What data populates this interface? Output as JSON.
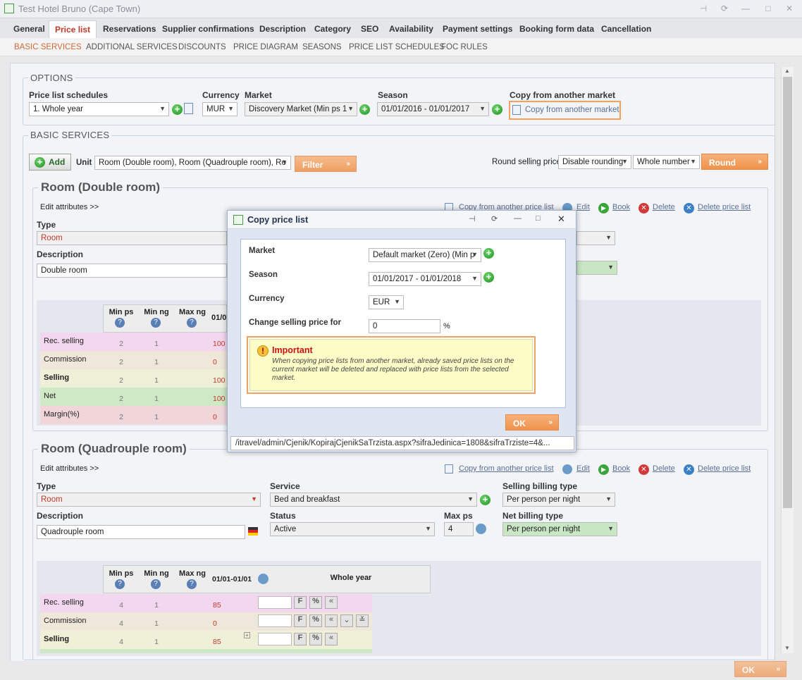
{
  "window": {
    "title": "Test Hotel Bruno (Cape Town)"
  },
  "tabs": [
    "General",
    "Price list",
    "Reservations",
    "Supplier confirmations",
    "Description",
    "Category",
    "SEO",
    "Availability",
    "Payment settings",
    "Booking form data",
    "Cancellation"
  ],
  "subtabs": [
    "BASIC SERVICES",
    "ADDITIONAL SERVICES",
    "DISCOUNTS",
    "PRICE DIAGRAM",
    "SEASONS",
    "PRICE LIST SCHEDULES",
    "FOC RULES"
  ],
  "options": {
    "legend": "OPTIONS",
    "schedules_label": "Price list schedules",
    "schedules_value": "1. Whole year",
    "currency_label": "Currency",
    "currency_value": "MUR",
    "market_label": "Market",
    "market_value": "Discovery Market (Min ps 1",
    "season_label": "Season",
    "season_value": "01/01/2016 - 01/01/2017",
    "copy_label": "Copy from another market",
    "copy_link": "Copy from another market"
  },
  "basic": {
    "legend": "BASIC SERVICES",
    "add": "Add",
    "unit_label": "Unit",
    "unit_value": "Room (Double room), Room (Quadrouple room), Ro",
    "filter": "Filter",
    "round_label": "Round selling price",
    "rounding_value": "Disable rounding",
    "number_value": "Whole number",
    "round_btn": "Round"
  },
  "room1": {
    "title": "Room (Double room)",
    "edit_attrs": "Edit attributes >>",
    "type_label": "Type",
    "type_value": "Room",
    "desc_label": "Description",
    "desc_value": "Double room",
    "actions": [
      "Copy from another price list",
      "Edit",
      "Book",
      "Delete",
      "Delete price list"
    ],
    "grid": {
      "headers": [
        "Min ps",
        "Min ng",
        "Max ng",
        "01/0"
      ],
      "rows": [
        {
          "label": "Rec. selling",
          "min_ps": "2",
          "min_ng": "1",
          "val": "100"
        },
        {
          "label": "Commission",
          "min_ps": "2",
          "min_ng": "1",
          "val": "0"
        },
        {
          "label": "Selling",
          "min_ps": "2",
          "min_ng": "1",
          "val": "100"
        },
        {
          "label": "Net",
          "min_ps": "2",
          "min_ng": "1",
          "val": "100"
        },
        {
          "label": "Margin(%)",
          "min_ps": "2",
          "min_ng": "1",
          "val": "0"
        }
      ]
    }
  },
  "room2": {
    "title": "Room (Quadrouple room)",
    "edit_attrs": "Edit attributes >>",
    "type_label": "Type",
    "type_value": "Room",
    "desc_label": "Description",
    "desc_value": "Quadrouple room",
    "service_label": "Service",
    "service_value": "Bed and breakfast",
    "status_label": "Status",
    "status_value": "Active",
    "maxps_label": "Max ps",
    "maxps_value": "4",
    "sbt_label": "Selling billing type",
    "sbt_value": "Per person per night",
    "nbt_label": "Net billing type",
    "nbt_value": "Per person per night",
    "actions": [
      "Copy from another price list",
      "Edit",
      "Book",
      "Delete",
      "Delete price list"
    ],
    "grid": {
      "headers": [
        "Min ps",
        "Min ng",
        "Max ng",
        "01/01-01/01",
        "Whole year"
      ],
      "rows": [
        {
          "label": "Rec. selling",
          "min_ps": "4",
          "min_ng": "1",
          "val": "85"
        },
        {
          "label": "Commission",
          "min_ps": "4",
          "min_ng": "1",
          "val": "0"
        },
        {
          "label": "Selling",
          "min_ps": "4",
          "min_ng": "1",
          "val": "85"
        }
      ],
      "btn_f": "F",
      "btn_pct": "%"
    }
  },
  "modal": {
    "title": "Copy price list",
    "market_label": "Market",
    "market_value": "Default market (Zero) (Min p",
    "season_label": "Season",
    "season_value": "01/01/2017 - 01/01/2018",
    "currency_label": "Currency",
    "currency_value": "EUR",
    "change_label": "Change selling price for",
    "change_value": "0",
    "pct": "%",
    "important_title": "Important",
    "important_text": "When copying price lists from another market, already saved price lists on the current market will be deleted and replaced with price lists from the selected market.",
    "ok": "OK",
    "url": "/itravel/admin/Cjenik/KopirajCjenikSaTrzista.aspx?sifraJedinica=1808&sifraTrziste=4&..."
  },
  "footer": {
    "ok": "OK"
  }
}
